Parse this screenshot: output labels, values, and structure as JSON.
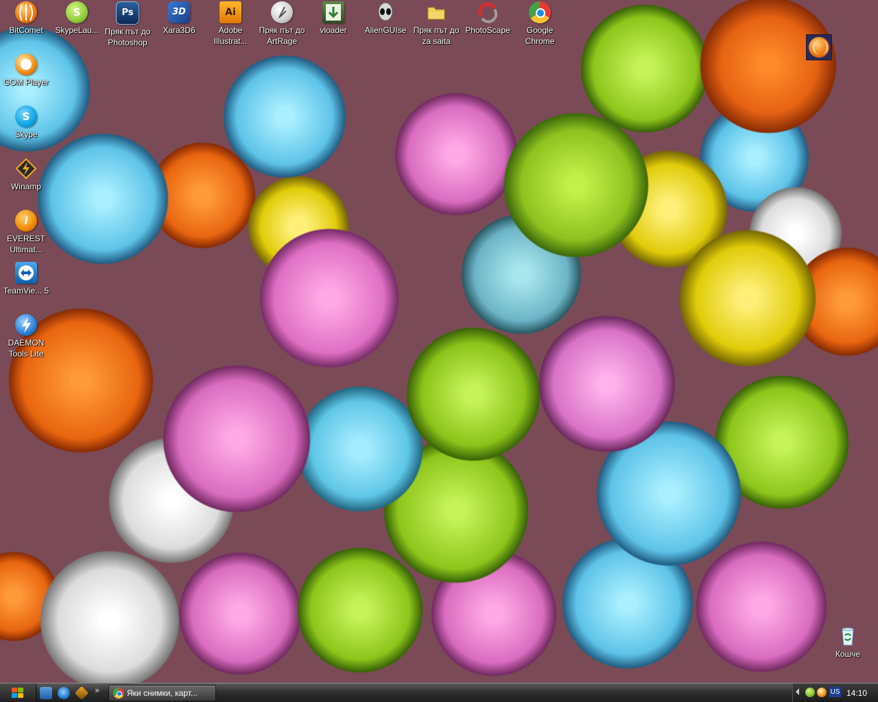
{
  "desktop": {
    "icons_top": [
      {
        "label": "BitComet",
        "icon": "bitcomet-icon"
      },
      {
        "label": "SkypeLau...",
        "icon": "skype-launcher-icon"
      },
      {
        "label": "Пряк път до Photoshop",
        "icon": "photoshop-icon"
      },
      {
        "label": "Xara3D6",
        "icon": "xara3d-icon"
      },
      {
        "label": "Adobe Illustrat...",
        "icon": "illustrator-icon"
      },
      {
        "label": "Пряк път до ArtRage",
        "icon": "artrage-icon"
      },
      {
        "label": "vloader",
        "icon": "vloader-icon"
      },
      {
        "label": "AlienGUIse",
        "icon": "alienguise-icon"
      },
      {
        "label": "Пряк път до za saita",
        "icon": "folder-icon"
      },
      {
        "label": "PhotoScape",
        "icon": "photoscape-icon"
      },
      {
        "label": "Google Chrome",
        "icon": "chrome-icon"
      }
    ],
    "icons_left": [
      {
        "label": "GOM Player",
        "icon": "gom-player-icon"
      },
      {
        "label": "Skype",
        "icon": "skype-icon"
      },
      {
        "label": "Winamp",
        "icon": "winamp-icon"
      },
      {
        "label": "EVEREST Ultimat...",
        "icon": "everest-icon"
      },
      {
        "label": "TeamVie... 5",
        "icon": "teamviewer-icon"
      },
      {
        "label": "DAEMON Tools Lite",
        "icon": "daemon-tools-icon"
      }
    ],
    "recycle_bin": {
      "label": "Кошче",
      "icon": "recycle-bin-icon"
    }
  },
  "taskbar": {
    "task_button": "Яки снимки, карт...",
    "quick_launch_more": "»",
    "language": "US",
    "clock": "14:10"
  }
}
